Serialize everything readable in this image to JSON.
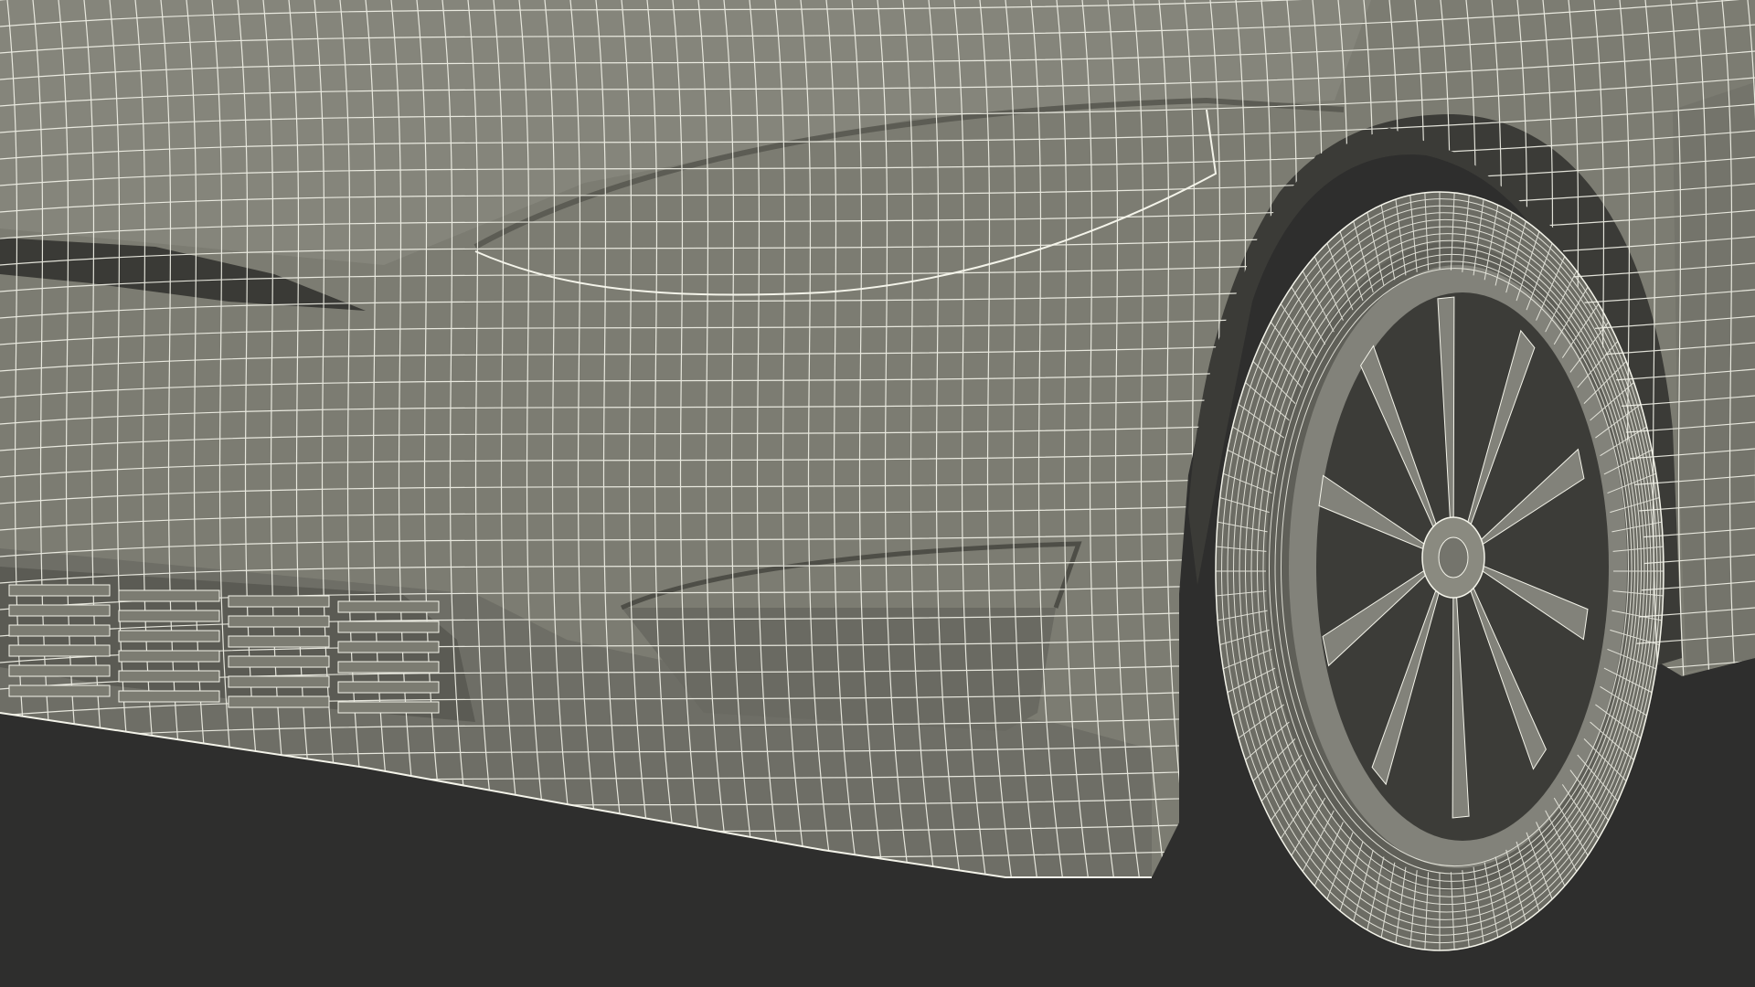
{
  "scene": {
    "subject": "wireframe-car-front-three-quarter",
    "colors": {
      "background": "#2e2e2d",
      "body": "#7c7c72",
      "body_light": "#8a8a80",
      "body_shadow": "#5e5e56",
      "dark_cavity": "#3a3a36",
      "wireline": "#f4f4ea",
      "tire": "#6c6c64",
      "rim": "#82827a"
    },
    "wheel": {
      "spoke_count": 10
    },
    "grille": {
      "slat_rows": 6,
      "slat_columns": 4
    }
  }
}
